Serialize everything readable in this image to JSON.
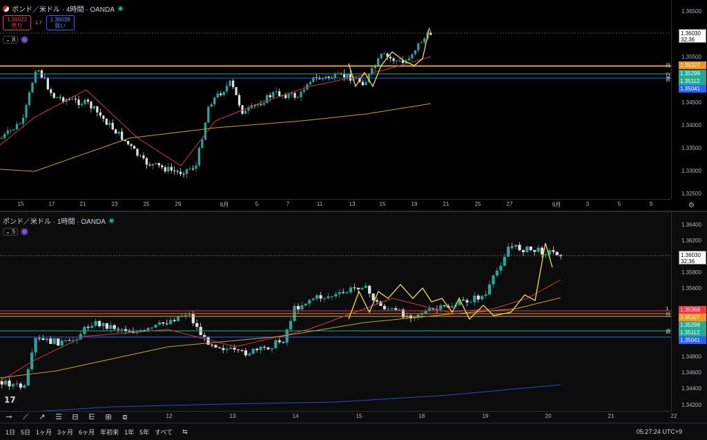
{
  "top": {
    "title": "ポンド／米ドル · 4時間 · OANDA",
    "sell_price": "1.36023",
    "sell_label": "売り",
    "spread": "1.7",
    "buy_price": "1.36039",
    "buy_label": "買い",
    "indicator_count": "8",
    "price_ticks": [
      "1.36500",
      "1.36000",
      "1.35500",
      "1.35000",
      "1.34500",
      "1.34000",
      "1.33500",
      "1.33000",
      "1.32500"
    ],
    "current_price": "1.36030",
    "countdown": "32:36",
    "level_tags": [
      {
        "value": "1.35327",
        "color": "#f7931a"
      },
      {
        "value": "1.35299",
        "color": "#22ab94"
      },
      {
        "value": "1.35112",
        "color": "#22ab94"
      },
      {
        "value": "1.35041",
        "color": "#2962ff"
      }
    ],
    "side_labels": [
      "月",
      "日",
      "週"
    ],
    "date_ticks": [
      "15",
      "17",
      "21",
      "23",
      "25",
      "29",
      "8月",
      "5",
      "7",
      "11",
      "13",
      "15",
      "19",
      "21",
      "25",
      "27",
      "9月",
      "3",
      "5",
      "9"
    ]
  },
  "bottom": {
    "title": "ポンド／米ドル · 1時間 · OANDA",
    "indicator_count": "5",
    "price_ticks": [
      "1.36400",
      "1.36200",
      "1.35800",
      "1.35600",
      "1.34800",
      "1.34600",
      "1.34400",
      "1.34200"
    ],
    "current_price": "1.36030",
    "countdown": "32:36",
    "level_tags": [
      {
        "value": "1.35368",
        "color": "#f23645"
      },
      {
        "value": "1.35327",
        "color": "#f7931a"
      },
      {
        "value": "1.35299",
        "color": "#22ab94"
      },
      {
        "value": "1.35112",
        "color": "#22ab94"
      },
      {
        "value": "1.35041",
        "color": "#2962ff"
      }
    ],
    "side_labels": [
      "1",
      "日",
      "日",
      "週"
    ],
    "date_ticks": [
      "12",
      "13",
      "14",
      "15",
      "18",
      "19",
      "20",
      "21",
      "22"
    ]
  },
  "ranges": [
    "1日",
    "5日",
    "1ヶ月",
    "3ヶ月",
    "6ヶ月",
    "年初来",
    "1年",
    "5年",
    "すべて"
  ],
  "clock": "05:27:24 UTC+9",
  "logo": "17"
}
